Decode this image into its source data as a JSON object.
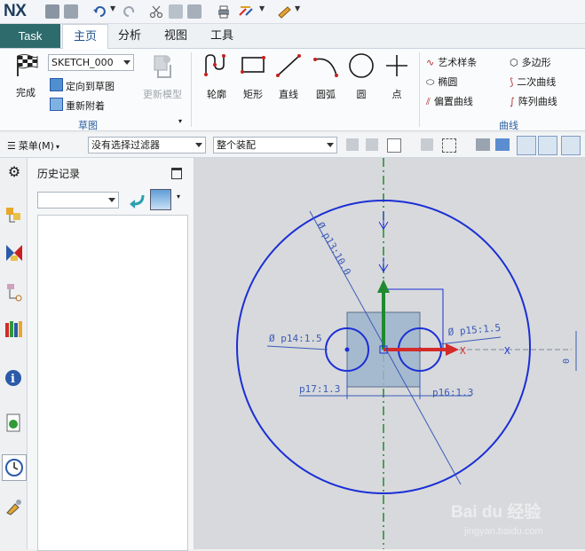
{
  "app": {
    "logo": "NX"
  },
  "tabs": [
    {
      "label": "Task"
    },
    {
      "label": "主页"
    },
    {
      "label": "分析"
    },
    {
      "label": "视图"
    },
    {
      "label": "工具"
    }
  ],
  "ribbon": {
    "sketch_group": {
      "finish_label": "完成",
      "sketch_name": "SKETCH_000",
      "orient_label": "定向到草图",
      "reattach_label": "重新附着",
      "update_model_label": "更新模型",
      "group_label": "草图"
    },
    "curve_tools": [
      {
        "label": "轮廓",
        "icon": "profile-icon"
      },
      {
        "label": "矩形",
        "icon": "rectangle-icon"
      },
      {
        "label": "直线",
        "icon": "line-icon"
      },
      {
        "label": "圆弧",
        "icon": "arc-icon"
      },
      {
        "label": "圆",
        "icon": "circle-icon"
      },
      {
        "label": "点",
        "icon": "point-icon"
      }
    ],
    "curve_small": [
      {
        "label": "艺术样条"
      },
      {
        "label": "多边形"
      },
      {
        "label": "椭圆"
      },
      {
        "label": "二次曲线"
      },
      {
        "label": "偏置曲线"
      },
      {
        "label": "阵列曲线"
      }
    ],
    "curve_group_label": "曲线"
  },
  "selbar": {
    "menu_label": "菜单(M)",
    "filter_value": "没有选择过滤器",
    "assembly_value": "整个装配"
  },
  "history": {
    "title": "历史记录",
    "combo_value": ""
  },
  "sketch": {
    "dims": {
      "p13": "Ø p13:10.0",
      "p14": "Ø p14:1.5",
      "p15": "Ø p15:1.5",
      "p16": "p16:1.3",
      "p17": "p17:1.3",
      "zero": "0"
    },
    "axis_marker": "X"
  },
  "watermark": {
    "brand": "Bai du 经验",
    "url": "jingyan.baidu.com"
  },
  "colors": {
    "task_tab": "#2e6b6c",
    "sketch_blue": "#1a2fd6",
    "axis_green": "#1f8a2f",
    "axis_red": "#d42a2a",
    "dim_blue": "#3a5bb8"
  }
}
